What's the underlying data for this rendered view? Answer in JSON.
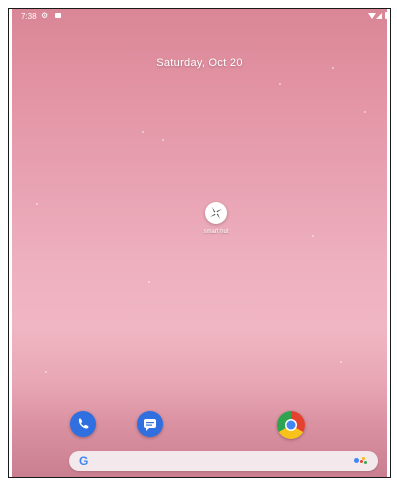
{
  "status_bar": {
    "time": "7:38",
    "icons": [
      "gear-icon",
      "sd-card-icon",
      "wifi-icon",
      "signal-icon",
      "battery-icon"
    ]
  },
  "home": {
    "date": "Saturday, Oct 20",
    "app_label": "smart hut",
    "app_icon": "shuriken-app-icon"
  },
  "dock": {
    "apps": [
      "phone-icon",
      "messages-icon",
      "chrome-icon"
    ]
  },
  "search": {
    "logo": "G",
    "assistant_icon": "google-assistant-icon"
  },
  "nav": {
    "buttons": [
      "back-icon",
      "home-icon",
      "recents-icon"
    ]
  },
  "colors": {
    "wallpaper_top": "#d98696",
    "wallpaper_mid": "#eeb0bf",
    "dock_blue": "#2f6fe0",
    "search_bg": "#f3e9ec"
  }
}
